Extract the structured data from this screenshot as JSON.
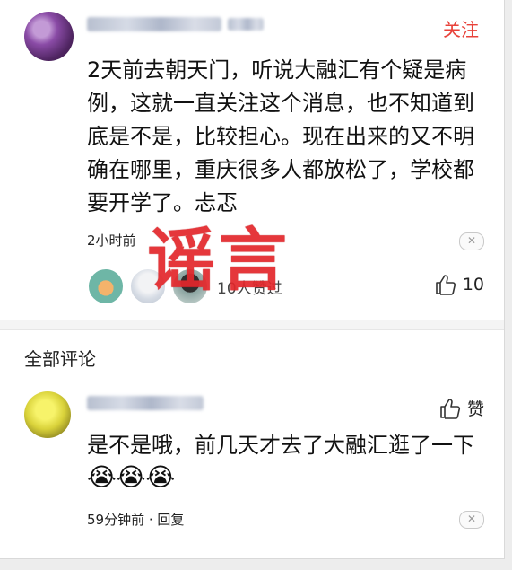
{
  "post": {
    "follow_label": "关注",
    "content": "2天前去朝天门，听说大融汇有个疑是病例，这就一直关注这个消息，也不知道到底是不是，比较担心。现在出来的又不明确在哪里，重庆很多人都放松了，学校都要开学了。忐忑",
    "time": "2小时前",
    "seen_text": "10人赞过",
    "like_count": "10",
    "watermark": "谣言"
  },
  "comments_section": {
    "title": "全部评论",
    "comment": {
      "like_label": "赞",
      "content": "是不是哦，前几天才去了大融汇逛了一下",
      "emojis": [
        "😭",
        "😭",
        "😭"
      ],
      "meta": "59分钟前 · 回复"
    }
  },
  "icons": {
    "close": "close-icon",
    "thumbs_up": "thumbs-up-icon"
  },
  "colors": {
    "follow": "#e8423a",
    "watermark": "#e3272b"
  }
}
